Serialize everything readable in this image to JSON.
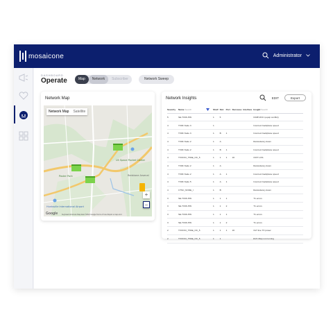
{
  "app": {
    "logo_text": "mosaicone",
    "user_label": "Administrator"
  },
  "page": {
    "breadcrumb": "DASHBOARD",
    "title": "Operate",
    "view_toggle": [
      "Map",
      "Network",
      "Subscriber"
    ],
    "sweep_button": "Network Sweep"
  },
  "map_card": {
    "title": "Network Map",
    "map_type": [
      "Network Map",
      "Satellite"
    ],
    "labels": {
      "poc": "US Space Pocket Center",
      "park": "Poster Park",
      "redstone": "Redstone Arsenal",
      "airport": "Huntsville International Airport"
    },
    "zoom_in": "+",
    "zoom_out": "−",
    "google": "Google",
    "footer": "Keyboard shortcuts   Map data ©2021 Google   Terms of Use   Report a map error"
  },
  "insights_card": {
    "title": "Network Insights",
    "edit_label": "EDIT",
    "export_label": "Export",
    "columns": [
      "Severity",
      "Name",
      "",
      "Shelf",
      "Slot",
      "Port",
      "Decrease",
      "Interface",
      "Insight"
    ],
    "filters": {
      "name": "Search",
      "insight": "Search"
    },
    "rows": [
      [
        "5",
        "SE-TX0K-HW",
        "",
        "1",
        "5",
        "",
        "",
        "",
        "ICMP-DVC (equip conflict)"
      ],
      [
        "4",
        "TX0K Node 3",
        "",
        "1",
        "",
        "",
        "",
        "",
        "Incorrect backplane speed"
      ],
      [
        "4",
        "TX0K Node 3",
        "",
        "1",
        "B",
        "1",
        "",
        "",
        "Incorrect backplane speed"
      ],
      [
        "4",
        "TX0K Node 2",
        "",
        "1",
        "A",
        "",
        "",
        "",
        "Redundancy down"
      ],
      [
        "4",
        "TX0K Node 2",
        "",
        "1",
        "B",
        "1",
        "",
        "",
        "Incorrect backplane speed"
      ],
      [
        "4",
        "TXOOCI_TSSE_OC_5",
        "",
        "1",
        "1",
        "1",
        "16",
        "",
        "OIXT LOS"
      ],
      [
        "4",
        "TX0K Node 2",
        "",
        "1",
        "A",
        "",
        "",
        "",
        "Redundancy down"
      ],
      [
        "4",
        "TX0K Node 2",
        "",
        "1",
        "A",
        "1",
        "",
        "",
        "Incorrect backplane speed"
      ],
      [
        "4",
        "TX0K Node 5",
        "",
        "1",
        "A",
        "1",
        "",
        "",
        "Incorrect backplane speed"
      ],
      [
        "4",
        "CTSC_NODE_I",
        "",
        "1",
        "B",
        "",
        "",
        "",
        "Redundancy down"
      ],
      [
        "3",
        "SE-TX0K-HW",
        "",
        "1",
        "1",
        "1",
        "",
        "",
        "T1 errors"
      ],
      [
        "3",
        "SE-TX0K-HW",
        "",
        "1",
        "1",
        "2",
        "",
        "",
        "T1 errors"
      ],
      [
        "3",
        "SE-TX0K-HW",
        "",
        "1",
        "1",
        "1",
        "",
        "",
        "T1 errors"
      ],
      [
        "3",
        "SE-TX0K-HW",
        "",
        "1",
        "1",
        "2",
        "",
        "",
        "T1 errors"
      ],
      [
        "2",
        "TXOOCI_TSSE_OC_5",
        "",
        "1",
        "1",
        "1",
        "16",
        "",
        "OLT line TX power"
      ],
      [
        "2",
        "TXOOCI_TSSE_OC_5",
        "",
        "1",
        "1",
        "",
        "",
        "",
        "EVC Map not running"
      ]
    ]
  }
}
